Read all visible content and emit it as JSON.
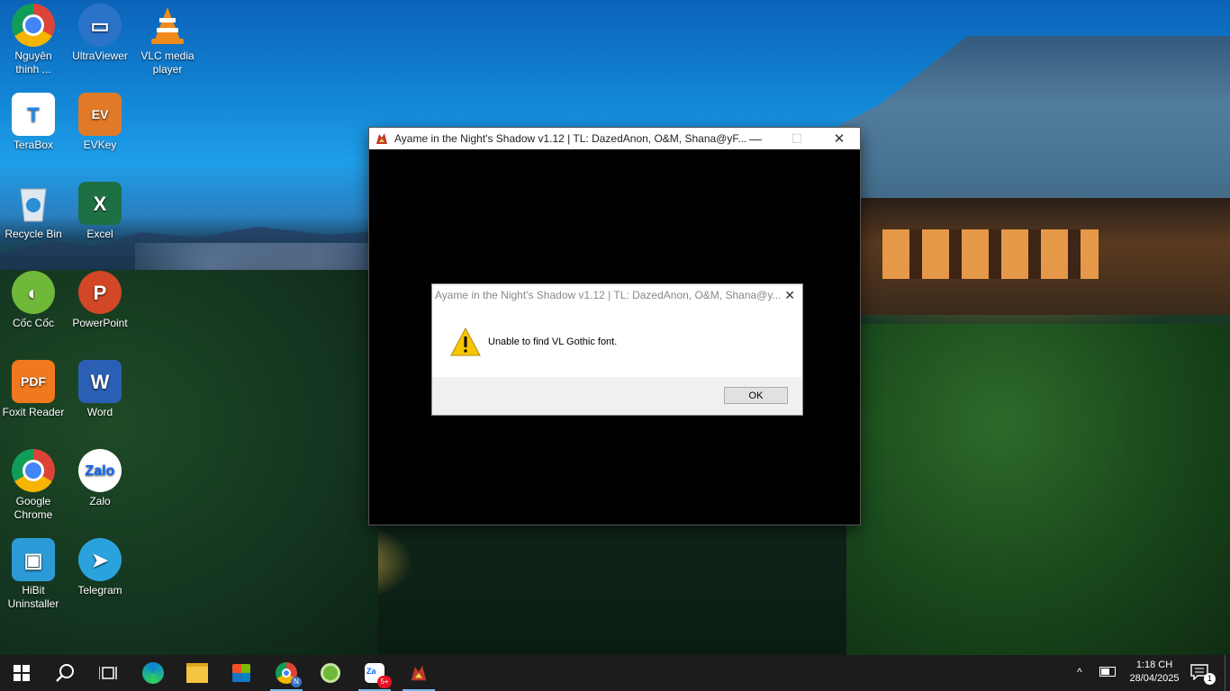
{
  "desktop": {
    "icons": [
      {
        "label": "Nguyên\nthinh ...",
        "icon": "chrome-profile-icon",
        "color": "#db4437"
      },
      {
        "label": "UltraViewer",
        "icon": "monitor-icon",
        "color": "#2a73c9"
      },
      {
        "label": "VLC media\nplayer",
        "icon": "vlc-cone-icon",
        "color": "#f08a1c"
      },
      {
        "label": "TeraBox",
        "icon": "terabox-icon",
        "color": "#1d8cf0"
      },
      {
        "label": "EVKey",
        "icon": "evkey-icon",
        "color": "#e07a28"
      },
      {
        "label": "Recycle Bin",
        "icon": "recycle-bin-icon",
        "color": "#cfd8e3"
      },
      {
        "label": "Excel",
        "icon": "excel-icon",
        "color": "#1d7044"
      },
      {
        "label": "Cốc Cốc",
        "icon": "coccoc-icon",
        "color": "#6fb83a"
      },
      {
        "label": "PowerPoint",
        "icon": "powerpoint-icon",
        "color": "#d24726"
      },
      {
        "label": "Foxit Reader",
        "icon": "foxit-icon",
        "color": "#f0791e"
      },
      {
        "label": "Word",
        "icon": "word-icon",
        "color": "#2b5fb4"
      },
      {
        "label": "Google\nChrome",
        "icon": "chrome-icon",
        "color": "#db4437"
      },
      {
        "label": "Zalo",
        "icon": "zalo-icon",
        "color": "#0a68ff"
      },
      {
        "label": "HiBit\nUninstaller",
        "icon": "hibit-icon",
        "color": "#2c9ad6"
      },
      {
        "label": "Telegram",
        "icon": "telegram-icon",
        "color": "#2aa3dc"
      }
    ]
  },
  "game_window": {
    "title": "Ayame in the Night's Shadow v1.12 | TL: DazedAnon, O&M, Shana@yF...",
    "minimize": "—",
    "maximize": "☐",
    "close": "✕"
  },
  "dialog": {
    "title": "Ayame in the Night's Shadow v1.12 | TL: DazedAnon, O&M, Shana@y...",
    "close": "✕",
    "message": "Unable to find VL Gothic font.",
    "ok_label": "OK"
  },
  "taskbar": {
    "search_icon": "search-icon",
    "zalo_badge": "5+",
    "chrome_badge": "N",
    "time": "1:18 CH",
    "date": "28/04/2025",
    "notification_count": "1"
  },
  "colors": {
    "taskbar_bg": "#1c1c1c",
    "accent": "#76b9ed",
    "warning": "#f7c600"
  }
}
